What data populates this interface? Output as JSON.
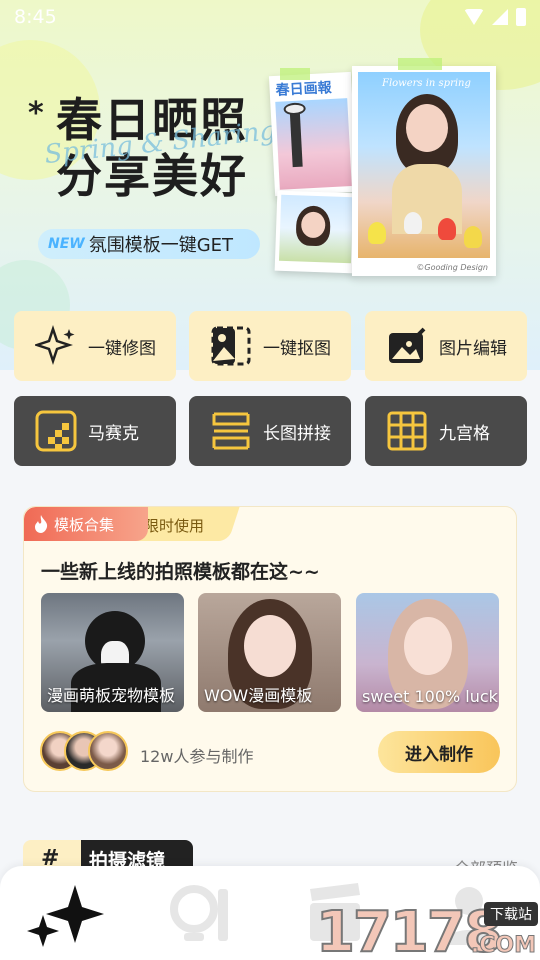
{
  "status_bar": {
    "time": "8:45"
  },
  "hero": {
    "title_line1": "春日晒照",
    "title_line2": "分享美好",
    "script": "Spring & Sharing",
    "tag_new": "NEW",
    "tag_text": "氛围模板一键GET",
    "photo1_caption": "春日画報",
    "photo2_top": "Flowers in spring",
    "photo2_credit": "©Gooding Design"
  },
  "tools": [
    {
      "label": "一键修图",
      "icon": "sparkle-icon"
    },
    {
      "label": "一键抠图",
      "icon": "cutout-icon"
    },
    {
      "label": "图片编辑",
      "icon": "brush-icon"
    },
    {
      "label": "马赛克",
      "icon": "mosaic-icon"
    },
    {
      "label": "长图拼接",
      "icon": "stitch-icon"
    },
    {
      "label": "九宫格",
      "icon": "grid-icon"
    }
  ],
  "template_card": {
    "tab_primary": "模板合集",
    "tab_secondary": "限时使用",
    "title": "一些新上线的拍照模板都在这~~",
    "items": [
      {
        "caption": "漫画萌板宠物模板"
      },
      {
        "caption": "WOW漫画模板"
      },
      {
        "caption": "sweet 100% luck"
      }
    ],
    "participants": "12w人参与制作",
    "enter_button": "进入制作"
  },
  "filter_section": {
    "hash": "#",
    "title": "拍摄滤镜",
    "all_link": "全部预览"
  },
  "bottom_nav": [
    {
      "icon": "sparkle-icon",
      "active": true
    },
    {
      "icon": "mirror-lipstick-icon",
      "active": false
    },
    {
      "icon": "clapperboard-icon",
      "active": false
    },
    {
      "icon": "person-icon",
      "active": false
    }
  ],
  "watermark": {
    "number": "17178",
    "tag": "下载站",
    "domain": ".COM"
  },
  "colors": {
    "accent_yellow": "#fdefc4",
    "dark_tile": "#4a4a4a",
    "tab_red": "#f06a55",
    "button_yellow": "#f9c55a"
  }
}
